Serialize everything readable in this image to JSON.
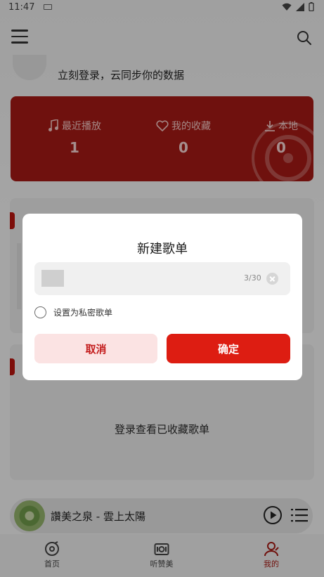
{
  "status_bar": {
    "time": "11:47"
  },
  "header": {
    "login_prompt": "立刻登录，云同步你的数据"
  },
  "stats": [
    {
      "label": "最近播放",
      "value": "1",
      "icon": "music-note-icon"
    },
    {
      "label": "我的收藏",
      "value": "0",
      "icon": "heart-icon"
    },
    {
      "label": "本地",
      "value": "0",
      "icon": "download-icon"
    }
  ],
  "favorites": {
    "empty_text": "登录查看已收藏歌单"
  },
  "player": {
    "song": "讚美之泉 - 雲上太陽"
  },
  "bottom_nav": [
    {
      "label": "首页",
      "icon": "home-disc-icon"
    },
    {
      "label": "听赞美",
      "icon": "listen-icon"
    },
    {
      "label": "我的",
      "icon": "person-icon",
      "active": true
    }
  ],
  "dialog": {
    "title": "新建歌单",
    "input": {
      "count": "3/30"
    },
    "private_label": "设置为私密歌单",
    "cancel_label": "取消",
    "confirm_label": "确定"
  },
  "colors": {
    "accent": "#dd1d12",
    "card": "#a41a15",
    "cancel_bg": "#fbe3e3"
  }
}
